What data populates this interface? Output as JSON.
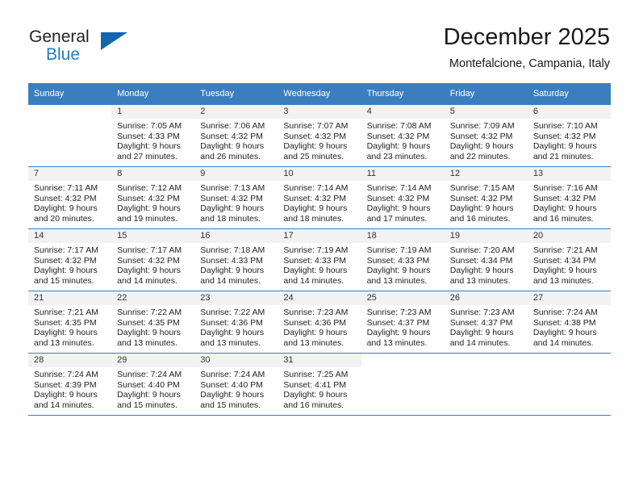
{
  "brand": {
    "name_part1": "General",
    "name_part2": "Blue",
    "accent_color": "#1266ab",
    "link_color": "#1f7ec4"
  },
  "header": {
    "title": "December 2025",
    "subtitle": "Montefalcione, Campania, Italy",
    "header_bg_color": "#3a7ebf"
  },
  "weekday_headers": [
    "Sunday",
    "Monday",
    "Tuesday",
    "Wednesday",
    "Thursday",
    "Friday",
    "Saturday"
  ],
  "weeks": [
    [
      {
        "day": "",
        "sunrise": "",
        "sunset": "",
        "daylight_line1": "",
        "daylight_line2": "",
        "empty": true
      },
      {
        "day": "1",
        "sunrise": "Sunrise: 7:05 AM",
        "sunset": "Sunset: 4:33 PM",
        "daylight_line1": "Daylight: 9 hours",
        "daylight_line2": "and 27 minutes."
      },
      {
        "day": "2",
        "sunrise": "Sunrise: 7:06 AM",
        "sunset": "Sunset: 4:32 PM",
        "daylight_line1": "Daylight: 9 hours",
        "daylight_line2": "and 26 minutes."
      },
      {
        "day": "3",
        "sunrise": "Sunrise: 7:07 AM",
        "sunset": "Sunset: 4:32 PM",
        "daylight_line1": "Daylight: 9 hours",
        "daylight_line2": "and 25 minutes."
      },
      {
        "day": "4",
        "sunrise": "Sunrise: 7:08 AM",
        "sunset": "Sunset: 4:32 PM",
        "daylight_line1": "Daylight: 9 hours",
        "daylight_line2": "and 23 minutes."
      },
      {
        "day": "5",
        "sunrise": "Sunrise: 7:09 AM",
        "sunset": "Sunset: 4:32 PM",
        "daylight_line1": "Daylight: 9 hours",
        "daylight_line2": "and 22 minutes."
      },
      {
        "day": "6",
        "sunrise": "Sunrise: 7:10 AM",
        "sunset": "Sunset: 4:32 PM",
        "daylight_line1": "Daylight: 9 hours",
        "daylight_line2": "and 21 minutes."
      }
    ],
    [
      {
        "day": "7",
        "sunrise": "Sunrise: 7:11 AM",
        "sunset": "Sunset: 4:32 PM",
        "daylight_line1": "Daylight: 9 hours",
        "daylight_line2": "and 20 minutes."
      },
      {
        "day": "8",
        "sunrise": "Sunrise: 7:12 AM",
        "sunset": "Sunset: 4:32 PM",
        "daylight_line1": "Daylight: 9 hours",
        "daylight_line2": "and 19 minutes."
      },
      {
        "day": "9",
        "sunrise": "Sunrise: 7:13 AM",
        "sunset": "Sunset: 4:32 PM",
        "daylight_line1": "Daylight: 9 hours",
        "daylight_line2": "and 18 minutes."
      },
      {
        "day": "10",
        "sunrise": "Sunrise: 7:14 AM",
        "sunset": "Sunset: 4:32 PM",
        "daylight_line1": "Daylight: 9 hours",
        "daylight_line2": "and 18 minutes."
      },
      {
        "day": "11",
        "sunrise": "Sunrise: 7:14 AM",
        "sunset": "Sunset: 4:32 PM",
        "daylight_line1": "Daylight: 9 hours",
        "daylight_line2": "and 17 minutes."
      },
      {
        "day": "12",
        "sunrise": "Sunrise: 7:15 AM",
        "sunset": "Sunset: 4:32 PM",
        "daylight_line1": "Daylight: 9 hours",
        "daylight_line2": "and 16 minutes."
      },
      {
        "day": "13",
        "sunrise": "Sunrise: 7:16 AM",
        "sunset": "Sunset: 4:32 PM",
        "daylight_line1": "Daylight: 9 hours",
        "daylight_line2": "and 16 minutes."
      }
    ],
    [
      {
        "day": "14",
        "sunrise": "Sunrise: 7:17 AM",
        "sunset": "Sunset: 4:32 PM",
        "daylight_line1": "Daylight: 9 hours",
        "daylight_line2": "and 15 minutes."
      },
      {
        "day": "15",
        "sunrise": "Sunrise: 7:17 AM",
        "sunset": "Sunset: 4:32 PM",
        "daylight_line1": "Daylight: 9 hours",
        "daylight_line2": "and 14 minutes."
      },
      {
        "day": "16",
        "sunrise": "Sunrise: 7:18 AM",
        "sunset": "Sunset: 4:33 PM",
        "daylight_line1": "Daylight: 9 hours",
        "daylight_line2": "and 14 minutes."
      },
      {
        "day": "17",
        "sunrise": "Sunrise: 7:19 AM",
        "sunset": "Sunset: 4:33 PM",
        "daylight_line1": "Daylight: 9 hours",
        "daylight_line2": "and 14 minutes."
      },
      {
        "day": "18",
        "sunrise": "Sunrise: 7:19 AM",
        "sunset": "Sunset: 4:33 PM",
        "daylight_line1": "Daylight: 9 hours",
        "daylight_line2": "and 13 minutes."
      },
      {
        "day": "19",
        "sunrise": "Sunrise: 7:20 AM",
        "sunset": "Sunset: 4:34 PM",
        "daylight_line1": "Daylight: 9 hours",
        "daylight_line2": "and 13 minutes."
      },
      {
        "day": "20",
        "sunrise": "Sunrise: 7:21 AM",
        "sunset": "Sunset: 4:34 PM",
        "daylight_line1": "Daylight: 9 hours",
        "daylight_line2": "and 13 minutes."
      }
    ],
    [
      {
        "day": "21",
        "sunrise": "Sunrise: 7:21 AM",
        "sunset": "Sunset: 4:35 PM",
        "daylight_line1": "Daylight: 9 hours",
        "daylight_line2": "and 13 minutes."
      },
      {
        "day": "22",
        "sunrise": "Sunrise: 7:22 AM",
        "sunset": "Sunset: 4:35 PM",
        "daylight_line1": "Daylight: 9 hours",
        "daylight_line2": "and 13 minutes."
      },
      {
        "day": "23",
        "sunrise": "Sunrise: 7:22 AM",
        "sunset": "Sunset: 4:36 PM",
        "daylight_line1": "Daylight: 9 hours",
        "daylight_line2": "and 13 minutes."
      },
      {
        "day": "24",
        "sunrise": "Sunrise: 7:23 AM",
        "sunset": "Sunset: 4:36 PM",
        "daylight_line1": "Daylight: 9 hours",
        "daylight_line2": "and 13 minutes."
      },
      {
        "day": "25",
        "sunrise": "Sunrise: 7:23 AM",
        "sunset": "Sunset: 4:37 PM",
        "daylight_line1": "Daylight: 9 hours",
        "daylight_line2": "and 13 minutes."
      },
      {
        "day": "26",
        "sunrise": "Sunrise: 7:23 AM",
        "sunset": "Sunset: 4:37 PM",
        "daylight_line1": "Daylight: 9 hours",
        "daylight_line2": "and 14 minutes."
      },
      {
        "day": "27",
        "sunrise": "Sunrise: 7:24 AM",
        "sunset": "Sunset: 4:38 PM",
        "daylight_line1": "Daylight: 9 hours",
        "daylight_line2": "and 14 minutes."
      }
    ],
    [
      {
        "day": "28",
        "sunrise": "Sunrise: 7:24 AM",
        "sunset": "Sunset: 4:39 PM",
        "daylight_line1": "Daylight: 9 hours",
        "daylight_line2": "and 14 minutes."
      },
      {
        "day": "29",
        "sunrise": "Sunrise: 7:24 AM",
        "sunset": "Sunset: 4:40 PM",
        "daylight_line1": "Daylight: 9 hours",
        "daylight_line2": "and 15 minutes."
      },
      {
        "day": "30",
        "sunrise": "Sunrise: 7:24 AM",
        "sunset": "Sunset: 4:40 PM",
        "daylight_line1": "Daylight: 9 hours",
        "daylight_line2": "and 15 minutes."
      },
      {
        "day": "31",
        "sunrise": "Sunrise: 7:25 AM",
        "sunset": "Sunset: 4:41 PM",
        "daylight_line1": "Daylight: 9 hours",
        "daylight_line2": "and 16 minutes."
      },
      {
        "day": "",
        "sunrise": "",
        "sunset": "",
        "daylight_line1": "",
        "daylight_line2": "",
        "empty": true
      },
      {
        "day": "",
        "sunrise": "",
        "sunset": "",
        "daylight_line1": "",
        "daylight_line2": "",
        "empty": true
      },
      {
        "day": "",
        "sunrise": "",
        "sunset": "",
        "daylight_line1": "",
        "daylight_line2": "",
        "empty": true
      }
    ]
  ]
}
